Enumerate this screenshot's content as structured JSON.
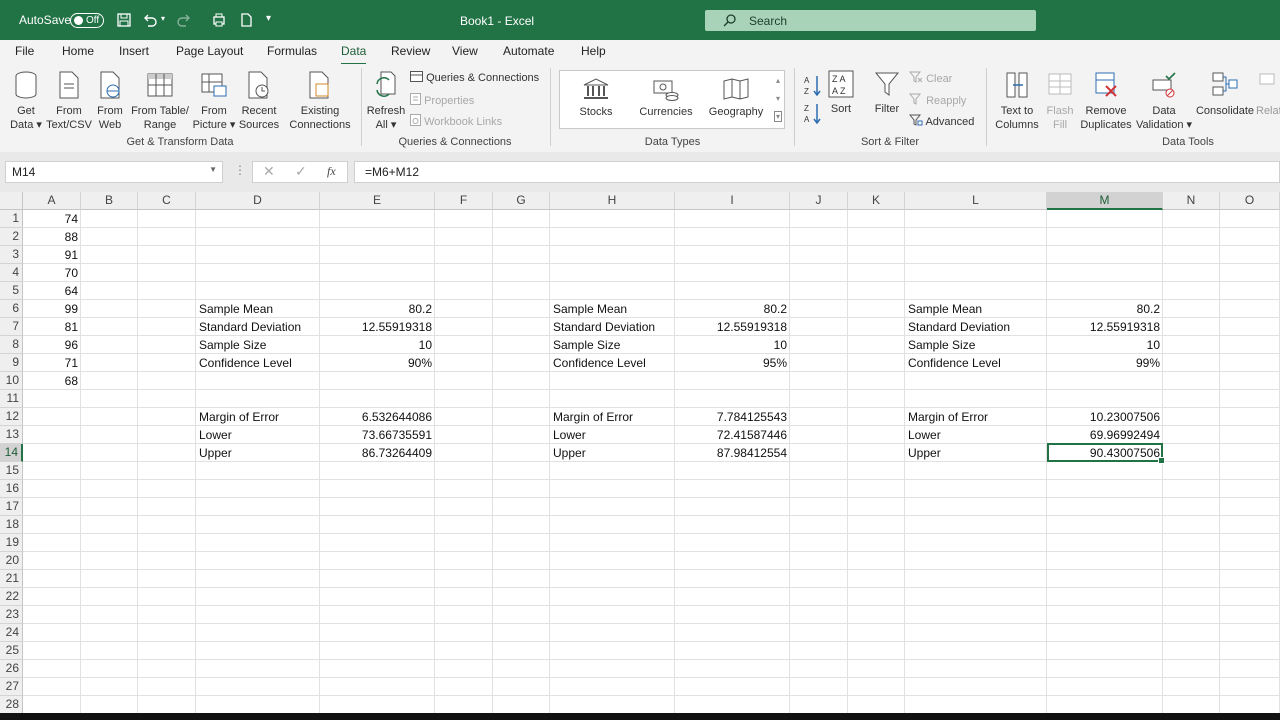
{
  "titlebar": {
    "autosave_label": "AutoSave",
    "toggle_state": "Off",
    "title": "Book1  -  Excel",
    "search_placeholder": "Search"
  },
  "tabs": [
    "File",
    "Home",
    "Insert",
    "Page Layout",
    "Formulas",
    "Data",
    "Review",
    "View",
    "Automate",
    "Help"
  ],
  "active_tab": "Data",
  "ribbon": {
    "get_data": [
      "Get",
      "Data"
    ],
    "from_text": [
      "From",
      "Text/CSV"
    ],
    "from_web": [
      "From",
      "Web"
    ],
    "from_table": [
      "From Table/",
      "Range"
    ],
    "from_picture": [
      "From",
      "Picture"
    ],
    "recent_sources": [
      "Recent",
      "Sources"
    ],
    "existing_connections": [
      "Existing",
      "Connections"
    ],
    "group_get_transform": "Get & Transform Data",
    "refresh_all": [
      "Refresh",
      "All"
    ],
    "queries_connections": "Queries & Connections",
    "properties": "Properties",
    "workbook_links": "Workbook Links",
    "group_queries": "Queries & Connections",
    "stocks": "Stocks",
    "currencies": "Currencies",
    "geography": "Geography",
    "group_data_types": "Data Types",
    "sort": "Sort",
    "filter": "Filter",
    "clear": "Clear",
    "reapply": "Reapply",
    "advanced": "Advanced",
    "group_sort_filter": "Sort & Filter",
    "text_to_columns": [
      "Text to",
      "Columns"
    ],
    "flash_fill": [
      "Flash",
      "Fill"
    ],
    "remove_duplicates": [
      "Remove",
      "Duplicates"
    ],
    "data_validation": [
      "Data",
      "Validation"
    ],
    "consolidate": "Consolidate",
    "relationships_cut": "Relati",
    "group_data_tools": "Data Tools"
  },
  "formula_bar": {
    "name_box": "M14",
    "formula": "=M6+M12"
  },
  "columns": [
    "A",
    "B",
    "C",
    "D",
    "E",
    "F",
    "G",
    "H",
    "I",
    "J",
    "K",
    "L",
    "M",
    "N",
    "O"
  ],
  "selected_column": "M",
  "rows": [
    "1",
    "2",
    "3",
    "4",
    "5",
    "6",
    "7",
    "8",
    "9",
    "10",
    "11",
    "12",
    "13",
    "14",
    "15",
    "16",
    "17",
    "18",
    "19",
    "20",
    "21",
    "22",
    "23",
    "24",
    "25",
    "26",
    "27",
    "28"
  ],
  "selected_row": "14",
  "col_a_values": [
    "74",
    "88",
    "91",
    "70",
    "64",
    "99",
    "81",
    "96",
    "71",
    "68"
  ],
  "blocks": [
    {
      "mean_label": "Sample Mean",
      "mean": "80.2",
      "sd_label": "Standard Deviation",
      "sd": "12.55919318",
      "size_label": "Sample Size",
      "size": "10",
      "cl_label": "Confidence Level",
      "cl": "90%",
      "moe_label": "Margin of Error",
      "moe": "6.532644086",
      "lower_label": "Lower",
      "lower": "73.66735591",
      "upper_label": "Upper",
      "upper": "86.73264409"
    },
    {
      "mean_label": "Sample Mean",
      "mean": "80.2",
      "sd_label": "Standard Deviation",
      "sd": "12.55919318",
      "size_label": "Sample Size",
      "size": "10",
      "cl_label": "Confidence Level",
      "cl": "95%",
      "moe_label": "Margin of Error",
      "moe": "7.784125543",
      "lower_label": "Lower",
      "lower": "72.41587446",
      "upper_label": "Upper",
      "upper": "87.98412554"
    },
    {
      "mean_label": "Sample Mean",
      "mean": "80.2",
      "sd_label": "Standard Deviation",
      "sd": "12.55919318",
      "size_label": "Sample Size",
      "size": "10",
      "cl_label": "Confidence Level",
      "cl": "99%",
      "moe_label": "Margin of Error",
      "moe": "10.23007506",
      "lower_label": "Lower",
      "lower": "69.96992494",
      "upper_label": "Upper",
      "upper": "90.43007506"
    }
  ],
  "colors": {
    "excel_green": "#217346",
    "search_bg": "#a9d3b8"
  }
}
